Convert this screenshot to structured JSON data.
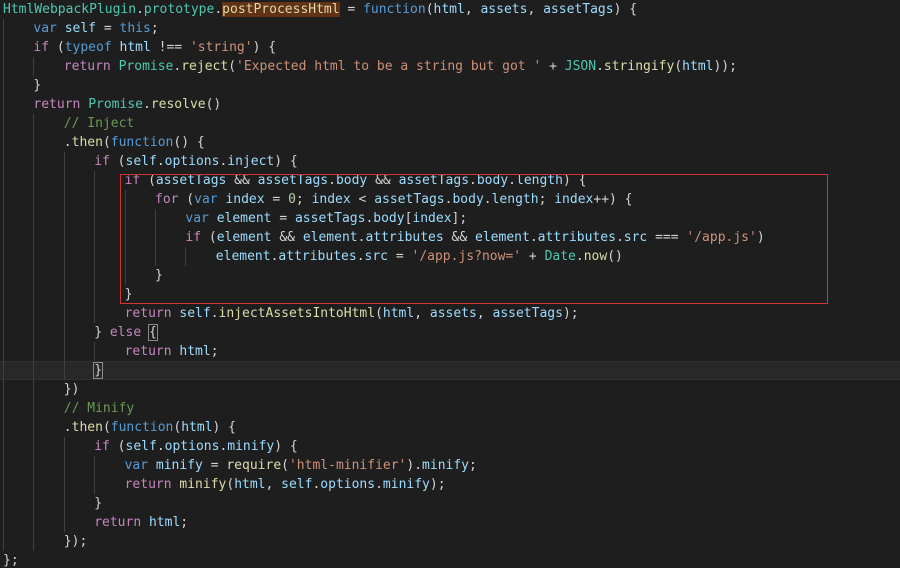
{
  "code_lines": [
    [
      [
        "cls",
        "HtmlWebpackPlugin"
      ],
      [
        "p",
        "."
      ],
      [
        "cls",
        "prototype"
      ],
      [
        "p",
        "."
      ],
      [
        "hl",
        "postProcessHtml"
      ],
      [
        "p",
        " = "
      ],
      [
        "k",
        "function"
      ],
      [
        "p",
        "("
      ],
      [
        "v",
        "html"
      ],
      [
        "p",
        ", "
      ],
      [
        "v",
        "assets"
      ],
      [
        "p",
        ", "
      ],
      [
        "v",
        "assetTags"
      ],
      [
        "p",
        ") {"
      ]
    ],
    [
      [
        "k",
        "var"
      ],
      [
        "p",
        " "
      ],
      [
        "v",
        "self"
      ],
      [
        "p",
        " = "
      ],
      [
        "k",
        "this"
      ],
      [
        "p",
        ";"
      ]
    ],
    [
      [
        "kc",
        "if"
      ],
      [
        "p",
        " ("
      ],
      [
        "k",
        "typeof"
      ],
      [
        "p",
        " "
      ],
      [
        "v",
        "html"
      ],
      [
        "p",
        " !== "
      ],
      [
        "s",
        "'string'"
      ],
      [
        "p",
        ") {"
      ]
    ],
    [
      [
        "kc",
        "return"
      ],
      [
        "p",
        " "
      ],
      [
        "cls",
        "Promise"
      ],
      [
        "p",
        "."
      ],
      [
        "f",
        "reject"
      ],
      [
        "p",
        "("
      ],
      [
        "s",
        "'Expected html to be a string but got '"
      ],
      [
        "p",
        " + "
      ],
      [
        "cls",
        "JSON"
      ],
      [
        "p",
        "."
      ],
      [
        "f",
        "stringify"
      ],
      [
        "p",
        "("
      ],
      [
        "v",
        "html"
      ],
      [
        "p",
        "));"
      ]
    ],
    [
      [
        "p",
        "}"
      ]
    ],
    [
      [
        "kc",
        "return"
      ],
      [
        "p",
        " "
      ],
      [
        "cls",
        "Promise"
      ],
      [
        "p",
        "."
      ],
      [
        "f",
        "resolve"
      ],
      [
        "p",
        "()"
      ]
    ],
    [
      [
        "c",
        "// Inject"
      ]
    ],
    [
      [
        "p",
        "."
      ],
      [
        "f",
        "then"
      ],
      [
        "p",
        "("
      ],
      [
        "k",
        "function"
      ],
      [
        "p",
        "() {"
      ]
    ],
    [
      [
        "kc",
        "if"
      ],
      [
        "p",
        " ("
      ],
      [
        "v",
        "self"
      ],
      [
        "p",
        "."
      ],
      [
        "v",
        "options"
      ],
      [
        "p",
        "."
      ],
      [
        "v",
        "inject"
      ],
      [
        "p",
        ") {"
      ]
    ],
    [
      [
        "kc",
        "if"
      ],
      [
        "p",
        " ("
      ],
      [
        "v",
        "assetTags"
      ],
      [
        "p",
        " && "
      ],
      [
        "v",
        "assetTags"
      ],
      [
        "p",
        "."
      ],
      [
        "v",
        "body"
      ],
      [
        "p",
        " && "
      ],
      [
        "v",
        "assetTags"
      ],
      [
        "p",
        "."
      ],
      [
        "v",
        "body"
      ],
      [
        "p",
        "."
      ],
      [
        "v",
        "length"
      ],
      [
        "p",
        ") {"
      ]
    ],
    [
      [
        "kc",
        "for"
      ],
      [
        "p",
        " ("
      ],
      [
        "k",
        "var"
      ],
      [
        "p",
        " "
      ],
      [
        "v",
        "index"
      ],
      [
        "p",
        " = "
      ],
      [
        "n",
        "0"
      ],
      [
        "p",
        "; "
      ],
      [
        "v",
        "index"
      ],
      [
        "p",
        " < "
      ],
      [
        "v",
        "assetTags"
      ],
      [
        "p",
        "."
      ],
      [
        "v",
        "body"
      ],
      [
        "p",
        "."
      ],
      [
        "v",
        "length"
      ],
      [
        "p",
        "; "
      ],
      [
        "v",
        "index"
      ],
      [
        "p",
        "++) {"
      ]
    ],
    [
      [
        "k",
        "var"
      ],
      [
        "p",
        " "
      ],
      [
        "v",
        "element"
      ],
      [
        "p",
        " = "
      ],
      [
        "v",
        "assetTags"
      ],
      [
        "p",
        "."
      ],
      [
        "v",
        "body"
      ],
      [
        "p",
        "["
      ],
      [
        "v",
        "index"
      ],
      [
        "p",
        "];"
      ]
    ],
    [
      [
        "kc",
        "if"
      ],
      [
        "p",
        " ("
      ],
      [
        "v",
        "element"
      ],
      [
        "p",
        " && "
      ],
      [
        "v",
        "element"
      ],
      [
        "p",
        "."
      ],
      [
        "v",
        "attributes"
      ],
      [
        "p",
        " && "
      ],
      [
        "v",
        "element"
      ],
      [
        "p",
        "."
      ],
      [
        "v",
        "attributes"
      ],
      [
        "p",
        "."
      ],
      [
        "v",
        "src"
      ],
      [
        "p",
        " === "
      ],
      [
        "s",
        "'/app.js'"
      ],
      [
        "p",
        ")"
      ]
    ],
    [
      [
        "v",
        "element"
      ],
      [
        "p",
        "."
      ],
      [
        "v",
        "attributes"
      ],
      [
        "p",
        "."
      ],
      [
        "v",
        "src"
      ],
      [
        "p",
        " = "
      ],
      [
        "s",
        "'/app.js?now='"
      ],
      [
        "p",
        " + "
      ],
      [
        "cls",
        "Date"
      ],
      [
        "p",
        "."
      ],
      [
        "f",
        "now"
      ],
      [
        "p",
        "()"
      ]
    ],
    [
      [
        "p",
        "}"
      ]
    ],
    [
      [
        "p",
        "}"
      ]
    ],
    [
      [
        "kc",
        "return"
      ],
      [
        "p",
        " "
      ],
      [
        "v",
        "self"
      ],
      [
        "p",
        "."
      ],
      [
        "f",
        "injectAssetsIntoHtml"
      ],
      [
        "p",
        "("
      ],
      [
        "v",
        "html"
      ],
      [
        "p",
        ", "
      ],
      [
        "v",
        "assets"
      ],
      [
        "p",
        ", "
      ],
      [
        "v",
        "assetTags"
      ],
      [
        "p",
        ");"
      ]
    ],
    [
      [
        "p",
        "} "
      ],
      [
        "kc",
        "else"
      ],
      [
        "p",
        " "
      ],
      [
        "bm",
        "{"
      ]
    ],
    [
      [
        "kc",
        "return"
      ],
      [
        "p",
        " "
      ],
      [
        "v",
        "html"
      ],
      [
        "p",
        ";"
      ]
    ],
    [
      [
        "bm",
        "}"
      ]
    ],
    [
      [
        "p",
        "})"
      ]
    ],
    [
      [
        "c",
        "// Minify"
      ]
    ],
    [
      [
        "p",
        "."
      ],
      [
        "f",
        "then"
      ],
      [
        "p",
        "("
      ],
      [
        "k",
        "function"
      ],
      [
        "p",
        "("
      ],
      [
        "v",
        "html"
      ],
      [
        "p",
        ") {"
      ]
    ],
    [
      [
        "kc",
        "if"
      ],
      [
        "p",
        " ("
      ],
      [
        "v",
        "self"
      ],
      [
        "p",
        "."
      ],
      [
        "v",
        "options"
      ],
      [
        "p",
        "."
      ],
      [
        "v",
        "minify"
      ],
      [
        "p",
        ") {"
      ]
    ],
    [
      [
        "k",
        "var"
      ],
      [
        "p",
        " "
      ],
      [
        "v",
        "minify"
      ],
      [
        "p",
        " = "
      ],
      [
        "f",
        "require"
      ],
      [
        "p",
        "("
      ],
      [
        "s",
        "'html-minifier'"
      ],
      [
        "p",
        ")."
      ],
      [
        "v",
        "minify"
      ],
      [
        "p",
        ";"
      ]
    ],
    [
      [
        "kc",
        "return"
      ],
      [
        "p",
        " "
      ],
      [
        "f",
        "minify"
      ],
      [
        "p",
        "("
      ],
      [
        "v",
        "html"
      ],
      [
        "p",
        ", "
      ],
      [
        "v",
        "self"
      ],
      [
        "p",
        "."
      ],
      [
        "v",
        "options"
      ],
      [
        "p",
        "."
      ],
      [
        "v",
        "minify"
      ],
      [
        "p",
        ");"
      ]
    ],
    [
      [
        "p",
        "}"
      ]
    ],
    [
      [
        "kc",
        "return"
      ],
      [
        "p",
        " "
      ],
      [
        "v",
        "html"
      ],
      [
        "p",
        ";"
      ]
    ],
    [
      [
        "p",
        "});"
      ]
    ],
    [
      [
        "p",
        "};"
      ]
    ]
  ]
}
